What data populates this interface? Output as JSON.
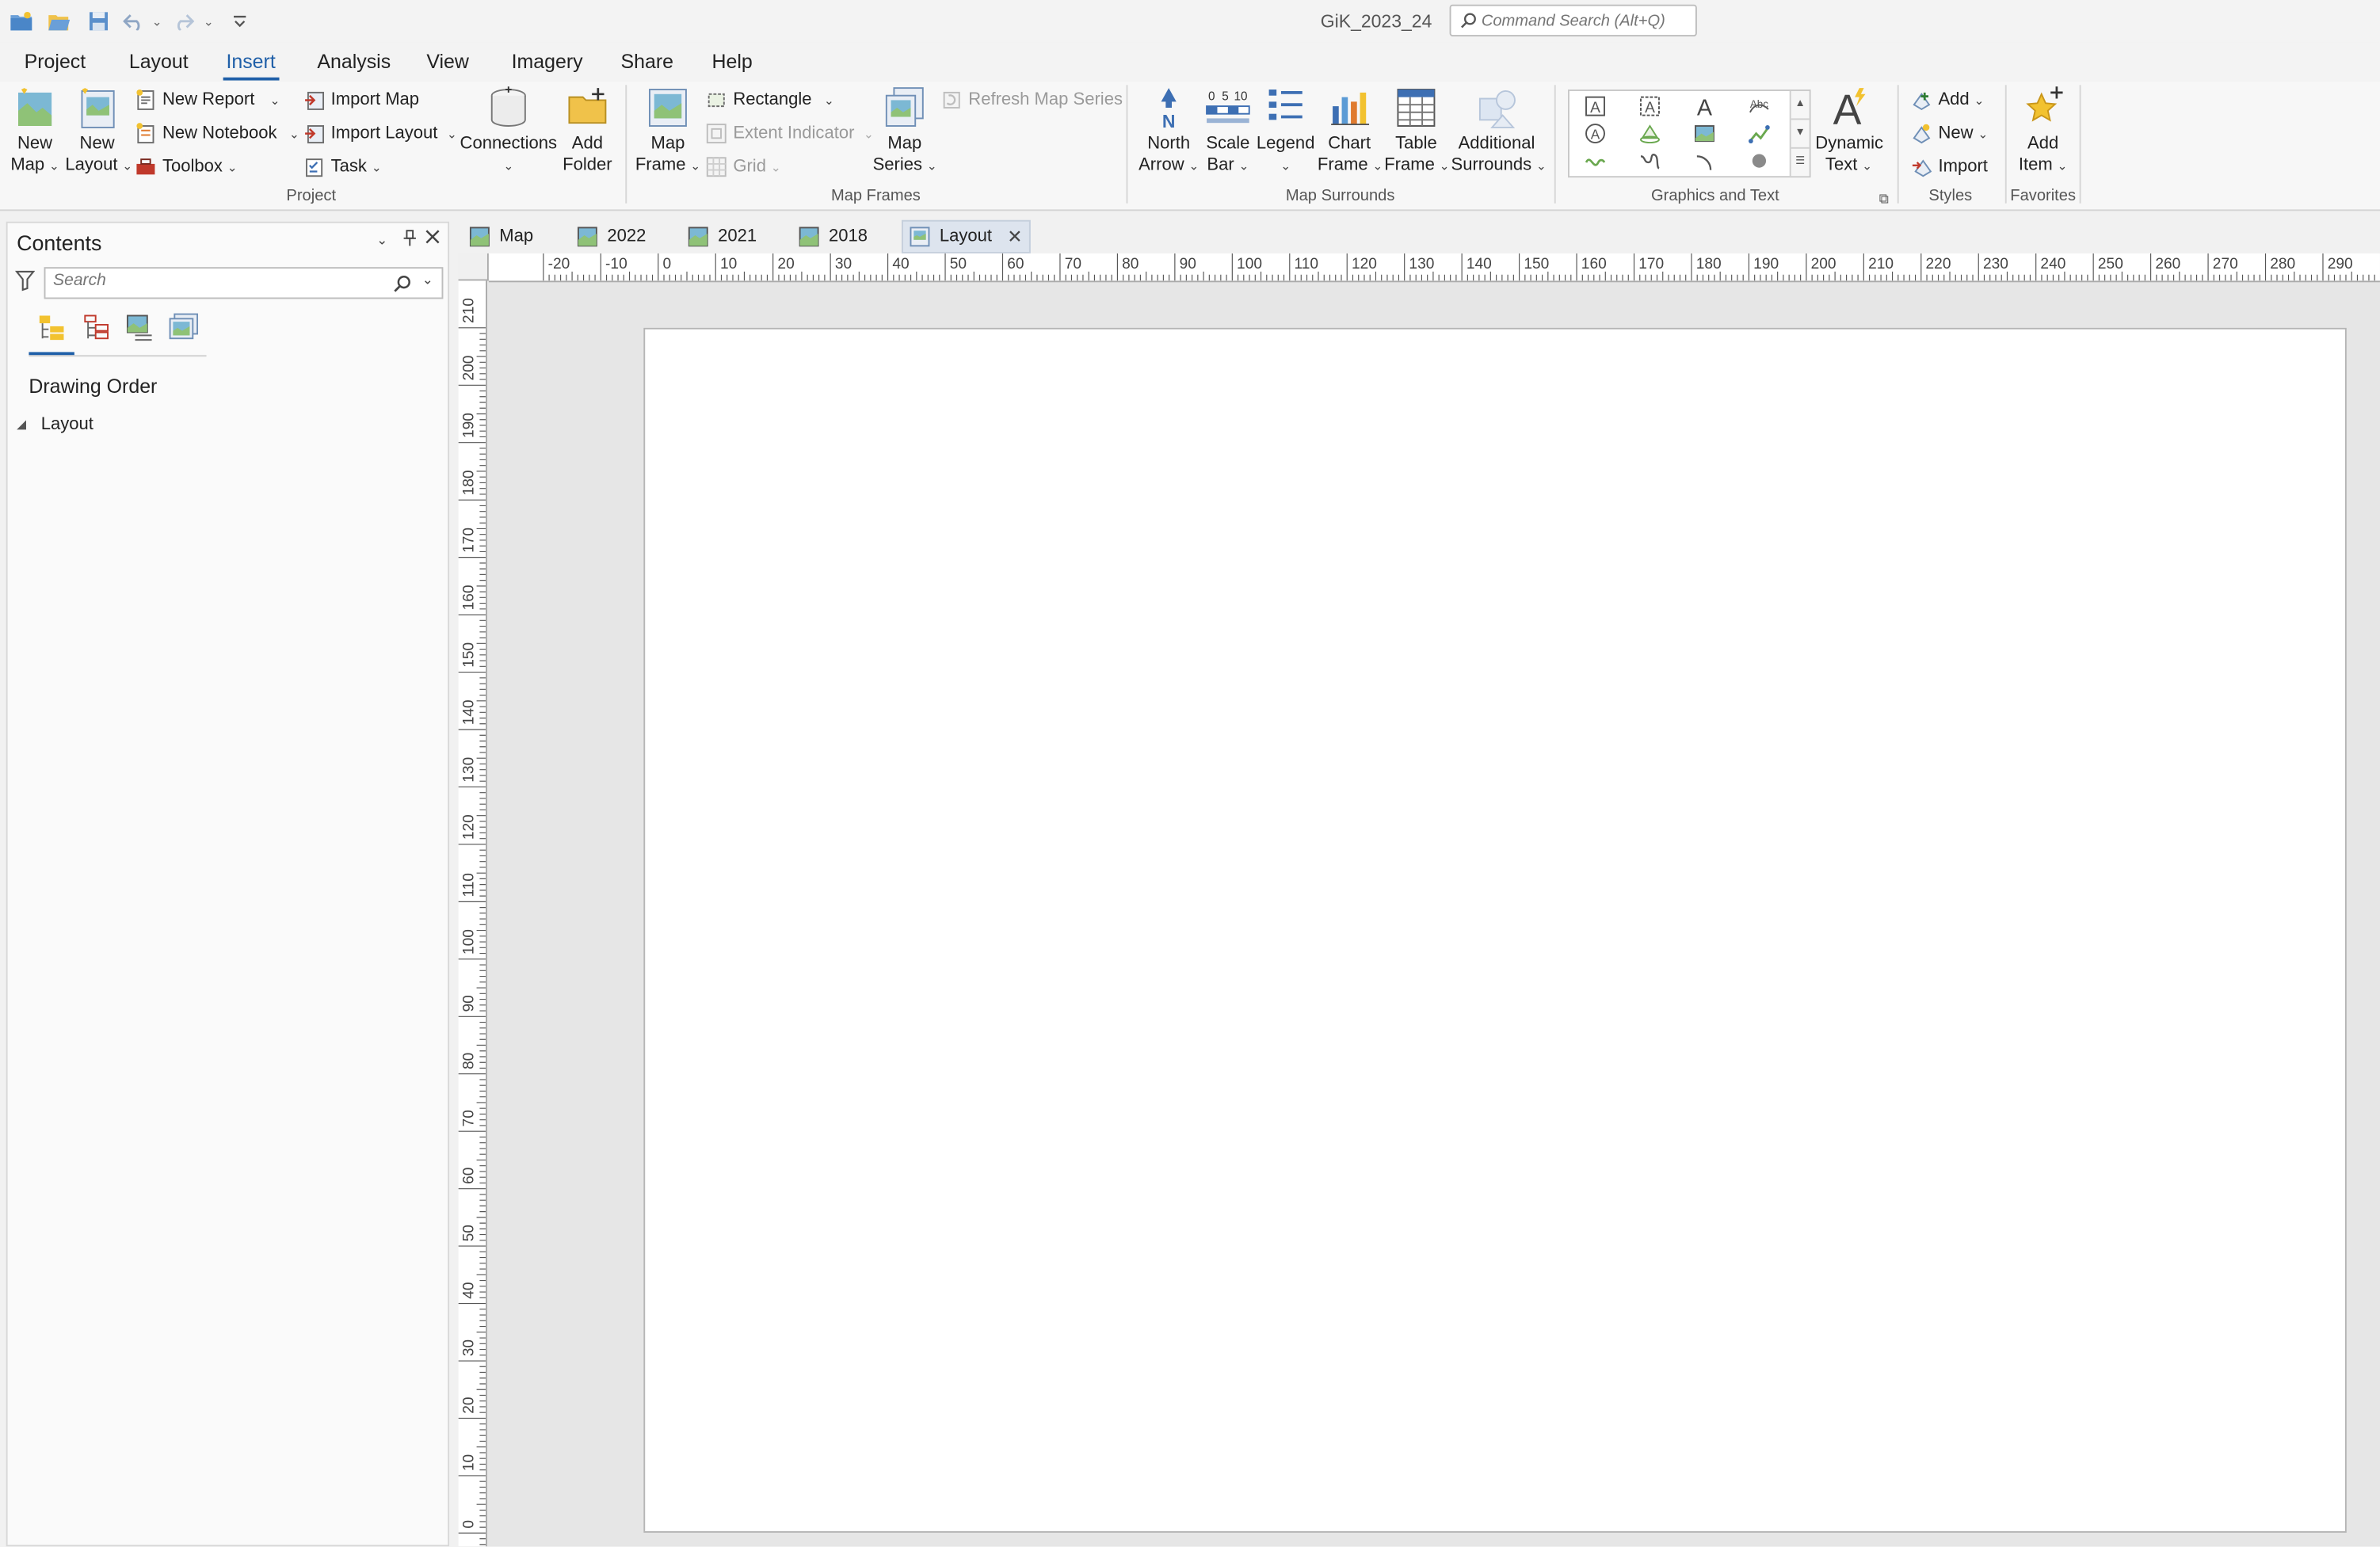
{
  "title_bar": {
    "app_title": "GiK_2023_24",
    "command_search_placeholder": "Command Search (Alt+Q)"
  },
  "ribbon_tabs": [
    "Project",
    "Layout",
    "Insert",
    "Analysis",
    "View",
    "Imagery",
    "Share",
    "Help"
  ],
  "active_ribbon_tab": "Insert",
  "ribbon": {
    "project": {
      "label": "Project",
      "new_map": [
        "New",
        "Map"
      ],
      "new_layout": [
        "New",
        "Layout"
      ],
      "new_report": "New Report",
      "new_notebook": "New Notebook",
      "toolbox": "Toolbox",
      "import_map": "Import Map",
      "import_layout": "Import Layout",
      "task": "Task",
      "connections": "Connections",
      "add_folder": [
        "Add",
        "Folder"
      ]
    },
    "map_frames": {
      "label": "Map Frames",
      "map_frame": [
        "Map",
        "Frame"
      ],
      "rectangle": "Rectangle",
      "extent_indicator": "Extent Indicator",
      "grid": "Grid",
      "map_series": [
        "Map",
        "Series"
      ],
      "refresh_map_series": "Refresh Map Series"
    },
    "map_surrounds": {
      "label": "Map Surrounds",
      "north_arrow": [
        "North",
        "Arrow"
      ],
      "scale_bar": [
        "Scale",
        "Bar"
      ],
      "legend": "Legend",
      "chart_frame": [
        "Chart",
        "Frame"
      ],
      "table_frame": [
        "Table",
        "Frame"
      ],
      "additional_surrounds": [
        "Additional",
        "Surrounds"
      ]
    },
    "graphics_text": {
      "label": "Graphics and Text",
      "dynamic_text": [
        "Dynamic",
        "Text"
      ]
    },
    "styles": {
      "label": "Styles",
      "add": "Add",
      "new": "New",
      "import": "Import"
    },
    "favorites": {
      "label": "Favorites",
      "add_item": [
        "Add",
        "Item"
      ]
    }
  },
  "contents": {
    "title": "Contents",
    "search_placeholder": "Search",
    "section": "Drawing Order",
    "items": [
      "Layout"
    ]
  },
  "doc_tabs": [
    "Map",
    "2022",
    "2021",
    "2018",
    "Layout"
  ],
  "active_doc_tab": "Layout",
  "rulers": {
    "horizontal_ticks": [
      "-20",
      "-10",
      "0",
      "10",
      "20",
      "30",
      "40",
      "50",
      "60",
      "70",
      "80",
      "90",
      "100",
      "110",
      "120",
      "130",
      "140",
      "150",
      "160",
      "170",
      "180",
      "190",
      "200",
      "210",
      "220",
      "230",
      "240",
      "250",
      "260",
      "270",
      "280",
      "290",
      "30"
    ],
    "vertical_ticks": [
      "210",
      "200",
      "190",
      "180",
      "170",
      "160",
      "150",
      "140",
      "130",
      "120",
      "110",
      "100",
      "90",
      "80",
      "70",
      "60",
      "50",
      "40",
      "30",
      "20",
      "10",
      "0"
    ]
  },
  "colors": {
    "accent": "#1f5fa8",
    "qat_icon": "#3d6fb3",
    "page": "#ffffff",
    "canvas": "#e6e6e6"
  }
}
